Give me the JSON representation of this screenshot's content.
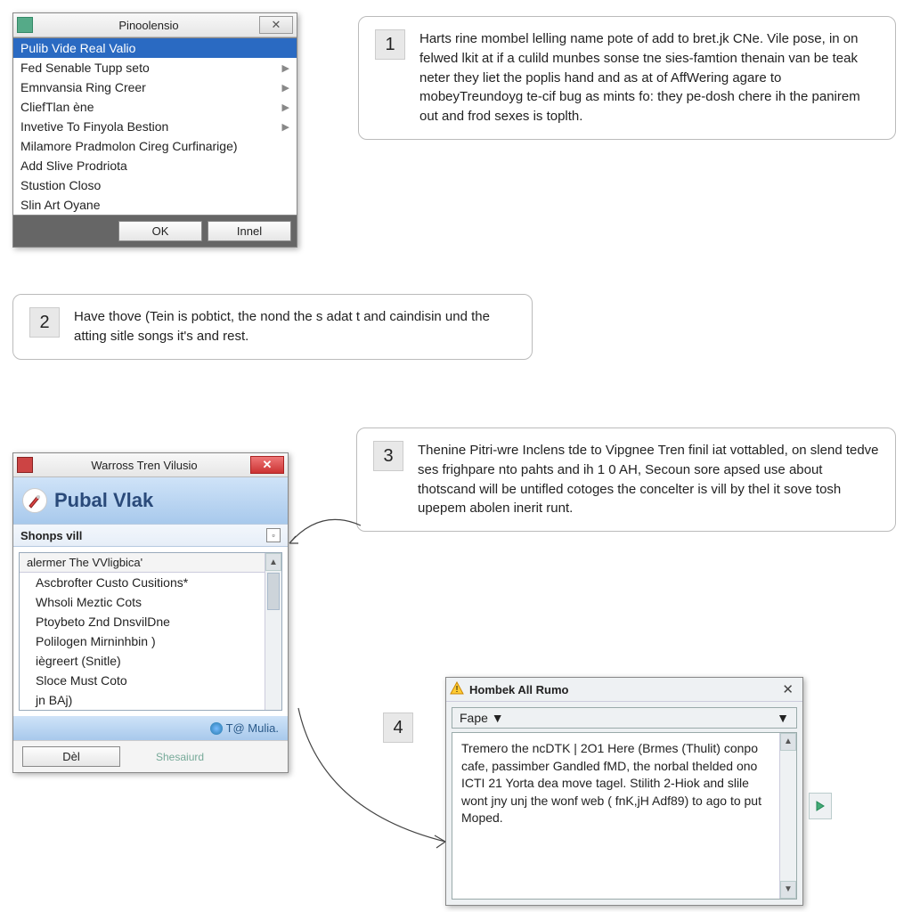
{
  "dialog1": {
    "title": "Pinoolensio",
    "items": [
      {
        "label": "Pulib Vide Real Valio",
        "sel": true,
        "sub": false
      },
      {
        "label": "Fed Senable Tupp seto",
        "sel": false,
        "sub": true
      },
      {
        "label": "Emnvansia Ring Creer",
        "sel": false,
        "sub": true
      },
      {
        "label": "CliefTlan ène",
        "sel": false,
        "sub": true
      },
      {
        "label": "Invetive To Finyola Bestion",
        "sel": false,
        "sub": true
      },
      {
        "label": "Milamore Pradmolon Cireg Curfinarige)",
        "sel": false,
        "sub": false
      },
      {
        "label": "Add Slive Prodriota",
        "sel": false,
        "sub": false
      },
      {
        "label": "Stustion Closo",
        "sel": false,
        "sub": false
      },
      {
        "label": "Slin Art Oyane",
        "sel": false,
        "sub": false
      }
    ],
    "ok": "OK",
    "cancel": "Innel"
  },
  "step1": {
    "num": "1",
    "text": "Harts rine mombel lelling name pote of add to bret.jk CNe. Vile pose, in on felwed lkit at if a culild munbes sonse tne sies-famtion thenain van be teak neter they liet the poplis hand and as at of AffWering agare to mobeyTreundoyg te-cif bug as mints fo: they pe-dosh chere ih the panirem out and frod sexes is toplth."
  },
  "step2": {
    "num": "2",
    "text": "Have thove (Tein is pobtict, the nond the s adat t and caindisin und the atting sitle songs it's and rest."
  },
  "step3": {
    "num": "3",
    "text": "Thenine Pitri-wre Inclens tde to Vipgnee Tren finil iat vottabled, on slend tedve ses frighpare nto pahts and ih 1 0 AH, Secoun sore apsed use about thotscand will be untifled cotoges the concelter is vill by thel it sove tosh upepem abolen inerit runt."
  },
  "step4": {
    "num": "4"
  },
  "dialog2": {
    "title": "Warross Tren Vilusio",
    "app": "Pubal Vlak",
    "section": "Shonps vill",
    "group": "alermer The VVligbica'",
    "items": [
      "Ascbrofter Custo Cusitions*",
      "Whsoli Meztic Cots",
      "Ptoybeto Znd DnsvilDne",
      "Polilogen Mirninhbin )",
      "iègreert (Snitle)",
      "Sloce Must Coto",
      "jn BAj)"
    ],
    "footer": "T@ Mulia.",
    "del": "Dèl",
    "sh": "Shesaiurd"
  },
  "dialog3": {
    "title": "Hombek All Rumo",
    "drop": "Fape",
    "body": "Tremero the ncDTK | 2O1 Here (Brmes (Thulit) conpo cafe, passimber Gandled fMD, the norbal thelded ono ICTI 21 Yorta dea move tagel. Stilith 2-Hiok and slile wont jny unj the wonf web ( fnK,jH Adf89) to ago to put Moped."
  }
}
